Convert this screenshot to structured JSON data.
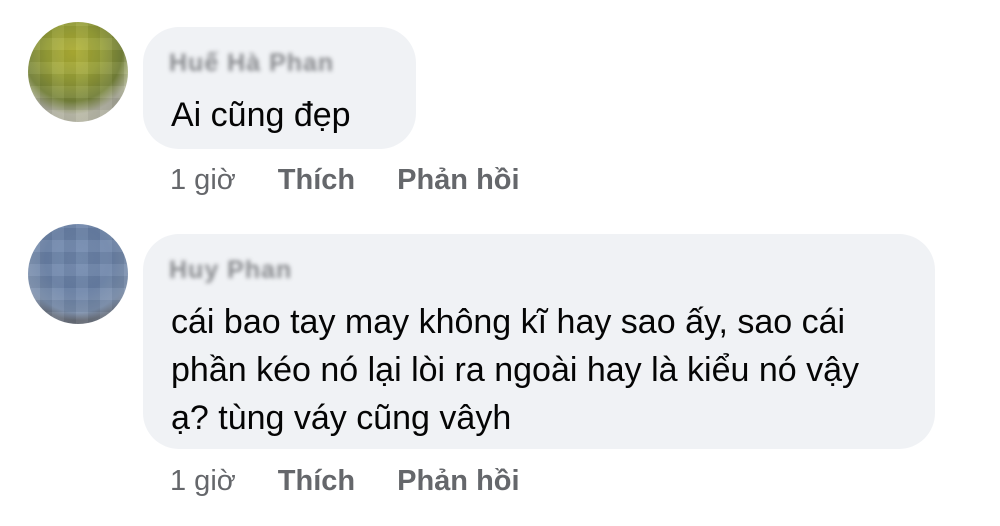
{
  "comments": [
    {
      "author": "Huế Hà Phan",
      "text_lines": [
        "Ai cũng đẹp"
      ],
      "time": "1 giờ",
      "like_label": "Thích",
      "reply_label": "Phản hồi"
    },
    {
      "author": "Huy Phan",
      "text_lines": [
        "cái bao tay may không kĩ hay sao ấy, sao cái",
        "phần kéo nó lại lòi ra ngoài hay là kiểu nó vậy",
        "ạ? tùng váy cũng vâyh"
      ],
      "time": "1 giờ",
      "like_label": "Thích",
      "reply_label": "Phản hồi"
    }
  ],
  "colors": {
    "bubble_background": "#f0f2f5",
    "text": "#050505",
    "secondary_text": "#65676b"
  }
}
